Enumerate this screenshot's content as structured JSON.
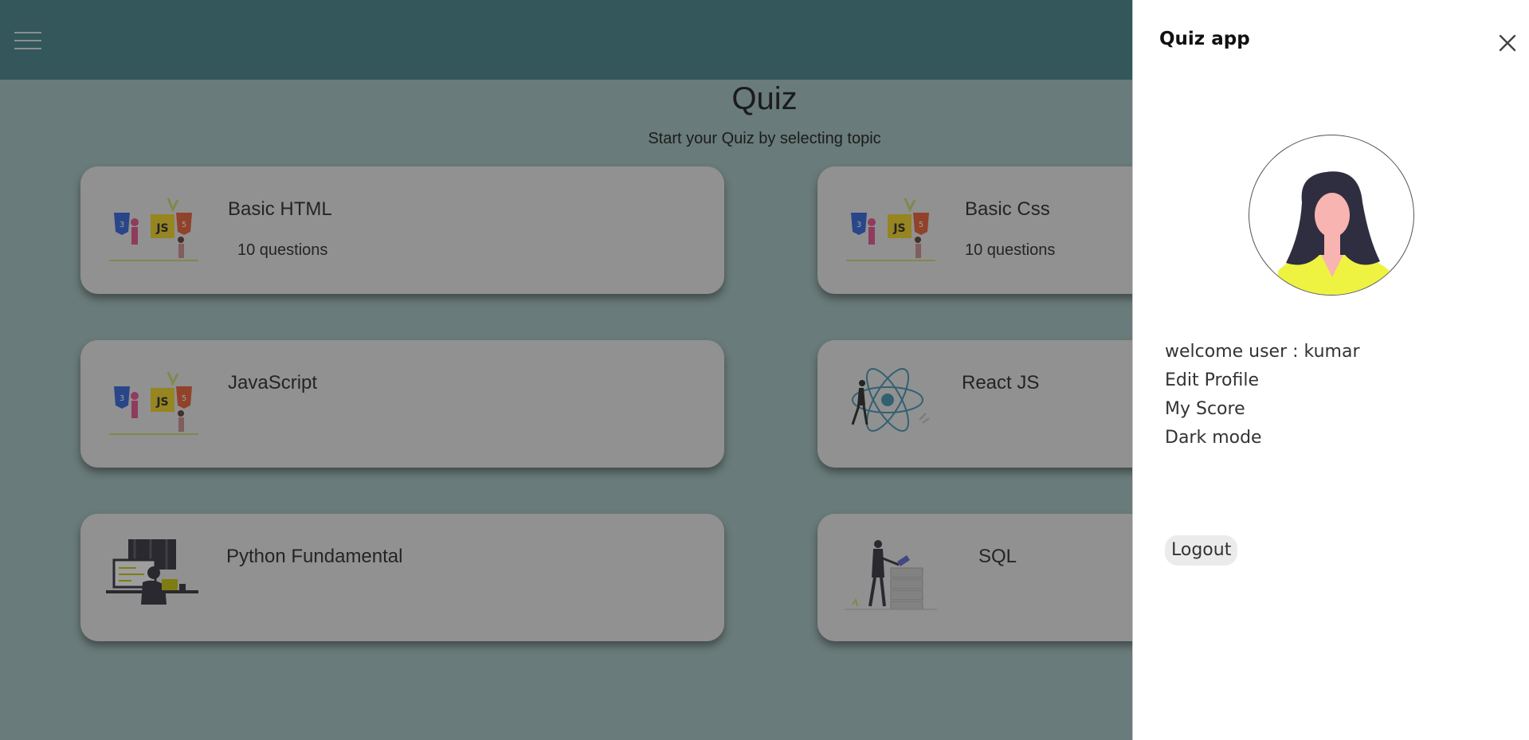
{
  "header": {
    "menu_icon": "hamburger-icon"
  },
  "main": {
    "title": "Quiz",
    "subtitle": "Start your Quiz by selecting topic",
    "quizzes": [
      {
        "title": "Basic HTML",
        "count": "10 questions",
        "image": "web-stack-illustration"
      },
      {
        "title": "Basic Css",
        "count": "10 questions",
        "image": "web-stack-illustration"
      },
      {
        "title": "JavaScript",
        "count": "",
        "image": "web-stack-illustration"
      },
      {
        "title": "React JS",
        "count": "",
        "image": "react-atom-illustration"
      },
      {
        "title": "Python Fundamental",
        "count": "",
        "image": "coding-desk-illustration"
      },
      {
        "title": "SQL",
        "count": "",
        "image": "database-illustration"
      }
    ]
  },
  "drawer": {
    "title": "Quiz app",
    "close_icon": "close-icon",
    "welcome": "welcome user : kumar",
    "menu": [
      "Edit Profile",
      "My Score",
      "Dark mode"
    ],
    "logout": "Logout"
  },
  "colors": {
    "header": "#3c7f86",
    "background": "#9fc0bd",
    "card": "#e8e8e8",
    "drawer": "#ffffff"
  }
}
